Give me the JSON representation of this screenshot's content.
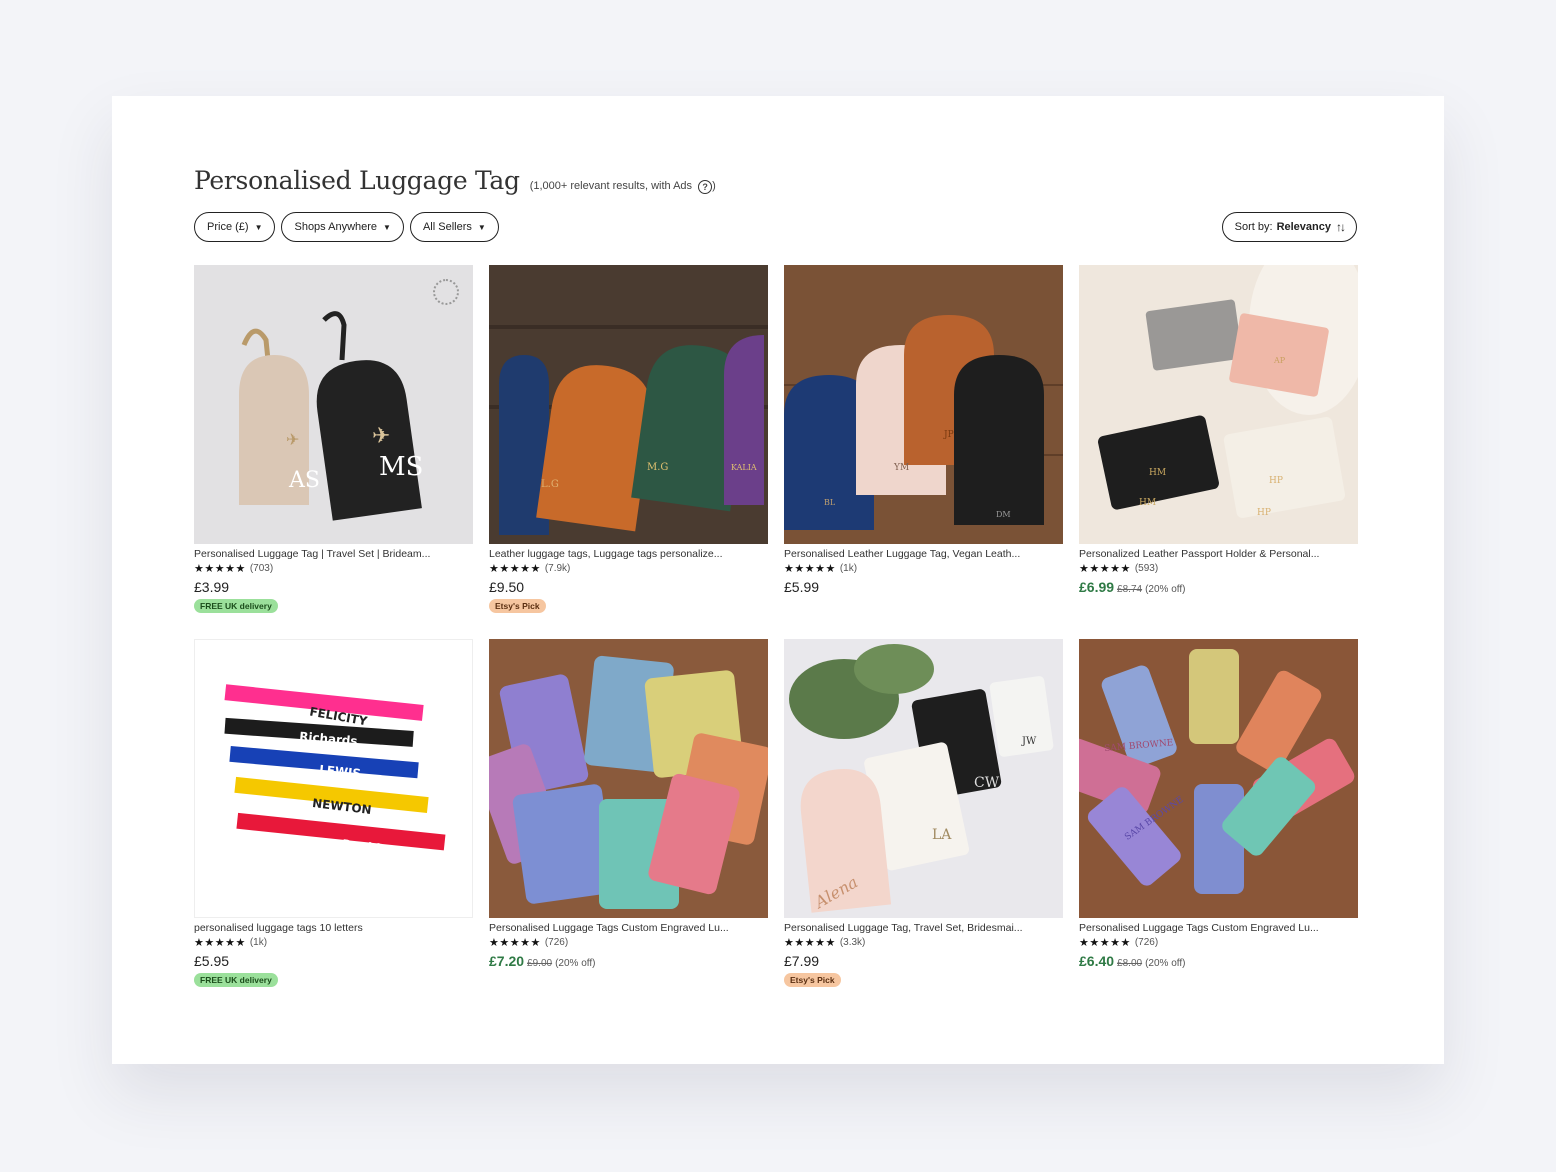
{
  "search": {
    "title": "Personalised Luggage Tag",
    "subtitle": "(1,000+ relevant results, with Ads",
    "subtitle_end": ")",
    "help_glyph": "?"
  },
  "filters": [
    {
      "label": "Price (£)"
    },
    {
      "label": "Shops Anywhere"
    },
    {
      "label": "All Sellers"
    }
  ],
  "sort": {
    "label": "Sort by:",
    "value": "Relevancy",
    "icon": "↑↓"
  },
  "stars": "★★★★★",
  "products": [
    {
      "title": "Personalised Luggage Tag | Travel Set | Brideam...",
      "reviews": "(703)",
      "price": "£3.99",
      "original": "",
      "discount": "",
      "badge": "FREE UK delivery"
    },
    {
      "title": "Leather luggage tags, Luggage tags personalize...",
      "reviews": "(7.9k)",
      "price": "£9.50",
      "original": "",
      "discount": "",
      "badge": "Etsy's Pick"
    },
    {
      "title": "Personalised Leather Luggage Tag, Vegan Leath...",
      "reviews": "(1k)",
      "price": "£5.99",
      "original": "",
      "discount": "",
      "badge": ""
    },
    {
      "title": "Personalized Leather Passport Holder & Personal...",
      "reviews": "(593)",
      "price": "£6.99",
      "original": "£8.74",
      "discount": "(20% off)",
      "badge": ""
    },
    {
      "title": "personalised luggage tags 10 letters",
      "reviews": "(1k)",
      "price": "£5.95",
      "original": "",
      "discount": "",
      "badge": "FREE UK delivery"
    },
    {
      "title": "Personalised Luggage Tags Custom Engraved Lu...",
      "reviews": "(726)",
      "price": "£7.20",
      "original": "£9.00",
      "discount": "(20% off)",
      "badge": ""
    },
    {
      "title": "Personalised Luggage Tag, Travel Set, Bridesmai...",
      "reviews": "(3.3k)",
      "price": "£7.99",
      "original": "",
      "discount": "",
      "badge": "Etsy's Pick"
    },
    {
      "title": "Personalised Luggage Tags Custom Engraved Lu...",
      "reviews": "(726)",
      "price": "£6.40",
      "original": "£8.00",
      "discount": "(20% off)",
      "badge": ""
    }
  ],
  "image_text": {
    "p1": [
      "AS",
      "MS"
    ],
    "p2": [
      "L.G",
      "M.G",
      "KALIA"
    ],
    "p3": [
      "BL",
      "YM",
      "JP",
      "DM"
    ],
    "p4": [
      "HM",
      "HM",
      "AP",
      "HP",
      "HP"
    ],
    "p5": [
      "FELICITY",
      "Richards",
      "LEWIS",
      "NEWTON",
      "David"
    ],
    "p7": [
      "Alena",
      "LA",
      "CW",
      "JW"
    ],
    "p8": [
      "SAM BROWNE",
      "SAM BROWNE"
    ]
  },
  "colors": {
    "sale_price": "#2f7a45",
    "free_badge": "#9be09b",
    "pick_badge": "#f6c6a0",
    "background": "#f3f4f8"
  }
}
